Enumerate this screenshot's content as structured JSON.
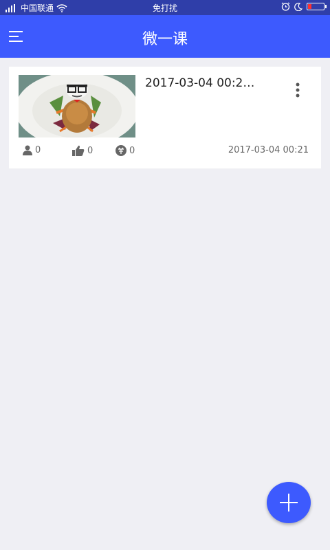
{
  "status_bar": {
    "carrier": "中国联通",
    "center_text": "免打扰",
    "icons": [
      "signal-icon",
      "wifi-icon",
      "alarm-icon",
      "moon-icon",
      "battery-icon"
    ],
    "battery_color": "#ff3030"
  },
  "app_bar": {
    "title": "微一课",
    "background": "#3d5afe"
  },
  "lessons": [
    {
      "title": "2017-03-04 00:2…",
      "views": "0",
      "likes": "0",
      "rewards": "0",
      "date": "2017-03-04 00:21",
      "thumbnail": "roast-chicken-plate"
    }
  ],
  "fab": {
    "icon": "plus-icon"
  }
}
